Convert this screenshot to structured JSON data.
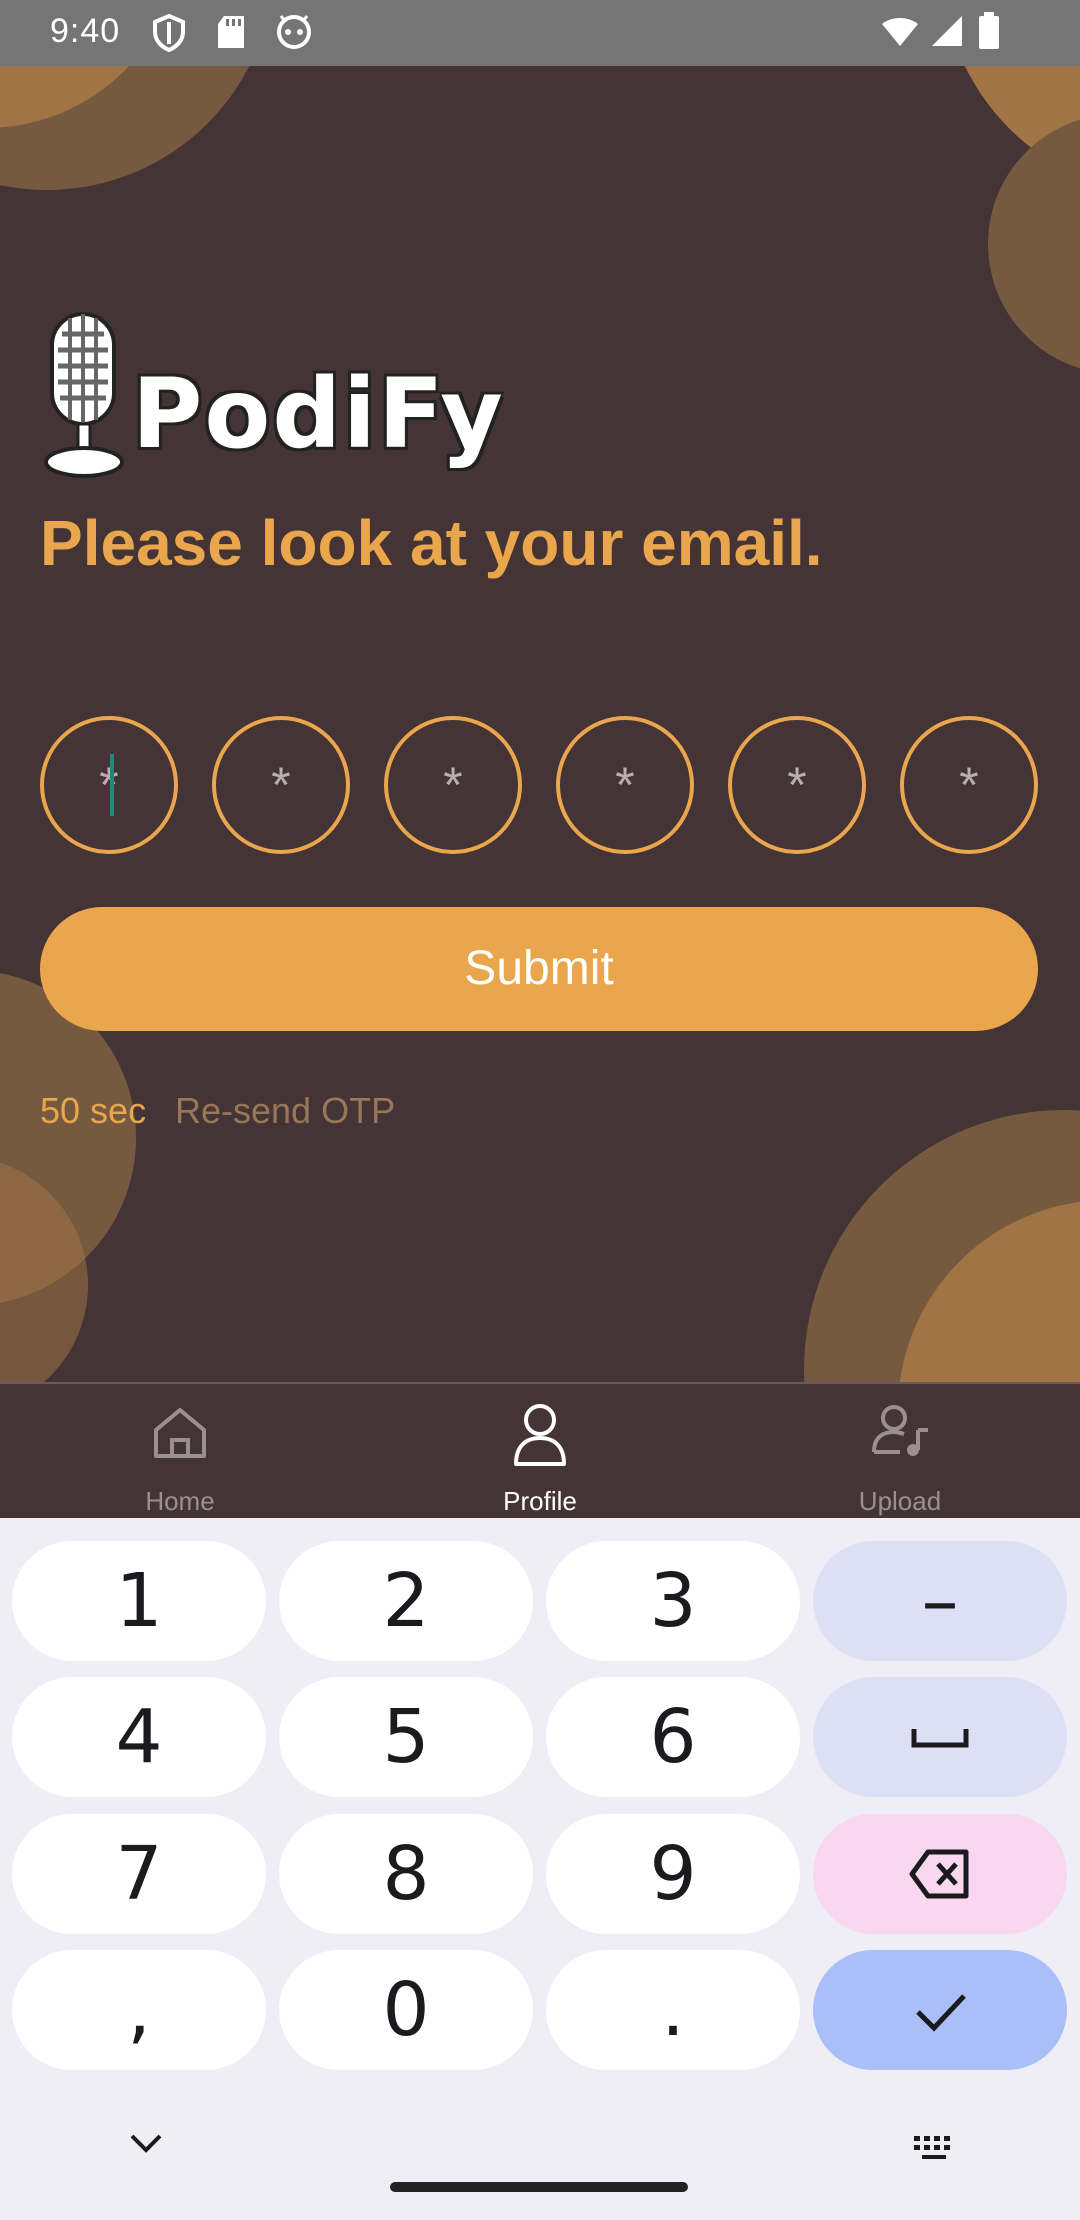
{
  "status_bar": {
    "time": "9:40",
    "icons": [
      "shield-icon",
      "sd-card-icon",
      "android-face-icon",
      "wifi-icon",
      "signal-icon",
      "battery-icon"
    ]
  },
  "brand": {
    "logo_text": "PodiFy",
    "logo_icon": "microphone-icon"
  },
  "otp": {
    "heading": "Please look at your email.",
    "cells": [
      "*",
      "*",
      "*",
      "*",
      "*",
      "*"
    ],
    "submit_label": "Submit",
    "timer": "50 sec",
    "resend_label": "Re-send OTP"
  },
  "bottom_nav": {
    "items": [
      {
        "label": "Home",
        "icon": "home-icon",
        "active": false
      },
      {
        "label": "Profile",
        "icon": "person-icon",
        "active": true
      },
      {
        "label": "Upload",
        "icon": "person-music-icon",
        "active": false
      }
    ]
  },
  "keyboard": {
    "rows": [
      [
        "1",
        "2",
        "3",
        "–"
      ],
      [
        "4",
        "5",
        "6",
        "␣"
      ],
      [
        "7",
        "8",
        "9",
        "⌫"
      ],
      [
        ",",
        "0",
        ".",
        "✓"
      ]
    ]
  },
  "colors": {
    "accent": "#eaa64d",
    "background": "#443436",
    "decor_dark": "#765a40",
    "decor_light": "#a07444",
    "nav_active": "#ffffff",
    "nav_inactive": "#9a9090"
  }
}
